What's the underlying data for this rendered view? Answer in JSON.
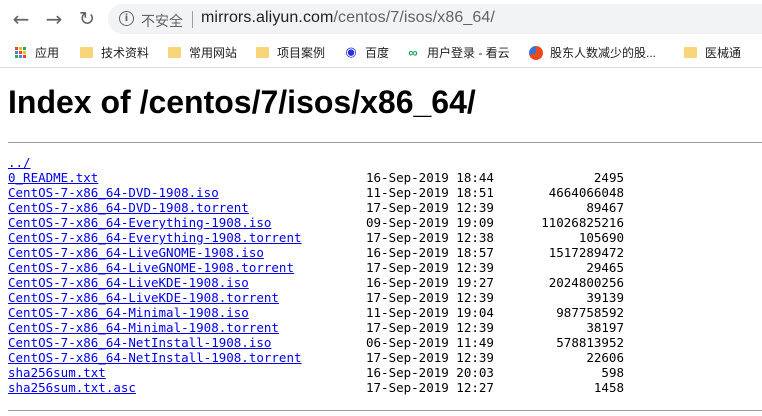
{
  "browser": {
    "insecure_label": "不安全",
    "url_host": "mirrors.aliyun.com",
    "url_path": "/centos/7/isos/x86_64/"
  },
  "bookmarks": [
    {
      "label": "应用",
      "icon": "apps-grid-icon"
    },
    {
      "label": "技术资料",
      "icon": "folder-icon"
    },
    {
      "label": "常用网站",
      "icon": "folder-icon"
    },
    {
      "label": "项目案例",
      "icon": "folder-icon"
    },
    {
      "label": "百度",
      "icon": "baidu-icon"
    },
    {
      "label": "用户登录 - 看云",
      "icon": "kancloud-icon"
    },
    {
      "label": "股东人数减少的股...",
      "icon": "pie-chart-icon"
    },
    {
      "label": "医械通",
      "icon": "folder-icon"
    }
  ],
  "page": {
    "title": "Index of /centos/7/isos/x86_64/",
    "parent_link": "../"
  },
  "files": [
    {
      "name": "0_README.txt",
      "date": "16-Sep-2019 18:44",
      "size": "2495"
    },
    {
      "name": "CentOS-7-x86_64-DVD-1908.iso",
      "date": "11-Sep-2019 18:51",
      "size": "4664066048"
    },
    {
      "name": "CentOS-7-x86_64-DVD-1908.torrent",
      "date": "17-Sep-2019 12:39",
      "size": "89467"
    },
    {
      "name": "CentOS-7-x86_64-Everything-1908.iso",
      "date": "09-Sep-2019 19:09",
      "size": "11026825216"
    },
    {
      "name": "CentOS-7-x86_64-Everything-1908.torrent",
      "date": "17-Sep-2019 12:38",
      "size": "105690"
    },
    {
      "name": "CentOS-7-x86_64-LiveGNOME-1908.iso",
      "date": "16-Sep-2019 18:57",
      "size": "1517289472"
    },
    {
      "name": "CentOS-7-x86_64-LiveGNOME-1908.torrent",
      "date": "17-Sep-2019 12:39",
      "size": "29465"
    },
    {
      "name": "CentOS-7-x86_64-LiveKDE-1908.iso",
      "date": "16-Sep-2019 19:27",
      "size": "2024800256"
    },
    {
      "name": "CentOS-7-x86_64-LiveKDE-1908.torrent",
      "date": "17-Sep-2019 12:39",
      "size": "39139"
    },
    {
      "name": "CentOS-7-x86_64-Minimal-1908.iso",
      "date": "11-Sep-2019 19:04",
      "size": "987758592"
    },
    {
      "name": "CentOS-7-x86_64-Minimal-1908.torrent",
      "date": "17-Sep-2019 12:39",
      "size": "38197"
    },
    {
      "name": "CentOS-7-x86_64-NetInstall-1908.iso",
      "date": "06-Sep-2019 11:49",
      "size": "578813952"
    },
    {
      "name": "CentOS-7-x86_64-NetInstall-1908.torrent",
      "date": "17-Sep-2019 12:39",
      "size": "22606"
    },
    {
      "name": "sha256sum.txt",
      "date": "16-Sep-2019 20:03",
      "size": "598"
    },
    {
      "name": "sha256sum.txt.asc",
      "date": "17-Sep-2019 12:27",
      "size": "1458"
    }
  ]
}
